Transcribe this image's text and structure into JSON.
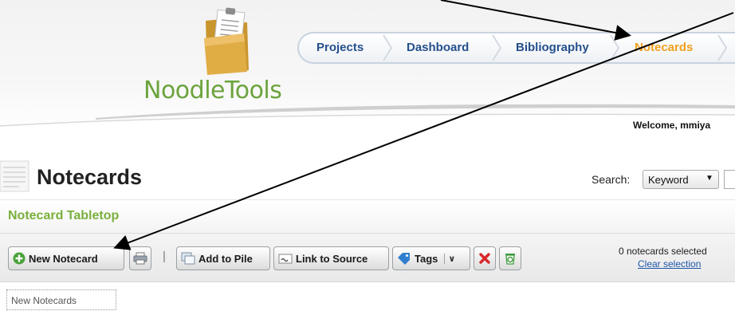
{
  "app": {
    "logo_text": "NoodleTools"
  },
  "nav": {
    "items": [
      {
        "label": "Projects",
        "active": false
      },
      {
        "label": "Dashboard",
        "active": false
      },
      {
        "label": "Bibliography",
        "active": false
      },
      {
        "label": "Notecards",
        "active": true
      }
    ],
    "active_color": "#f0a020",
    "link_color": "#25508c"
  },
  "header": {
    "welcome": "Welcome, mmiya"
  },
  "page": {
    "title": "Notecards"
  },
  "search": {
    "label": "Search:",
    "mode": "Keyword"
  },
  "tabletop": {
    "title": "Notecard Tabletop",
    "title_color": "#7ab03c"
  },
  "toolbar": {
    "new_notecard": "New Notecard",
    "add_to_pile": "Add to Pile",
    "link_to_source": "Link to Source",
    "tags": "Tags",
    "separator": "|",
    "selected_count": "0 notecards selected",
    "clear_selection": "Clear selection",
    "icons": [
      "plus-circle-icon",
      "print-icon",
      "cards-icon",
      "link-icon",
      "tag-icon",
      "chevron-down-icon",
      "delete-icon",
      "recycle-icon"
    ]
  },
  "piles": [
    {
      "label": "New Notecards"
    }
  ]
}
